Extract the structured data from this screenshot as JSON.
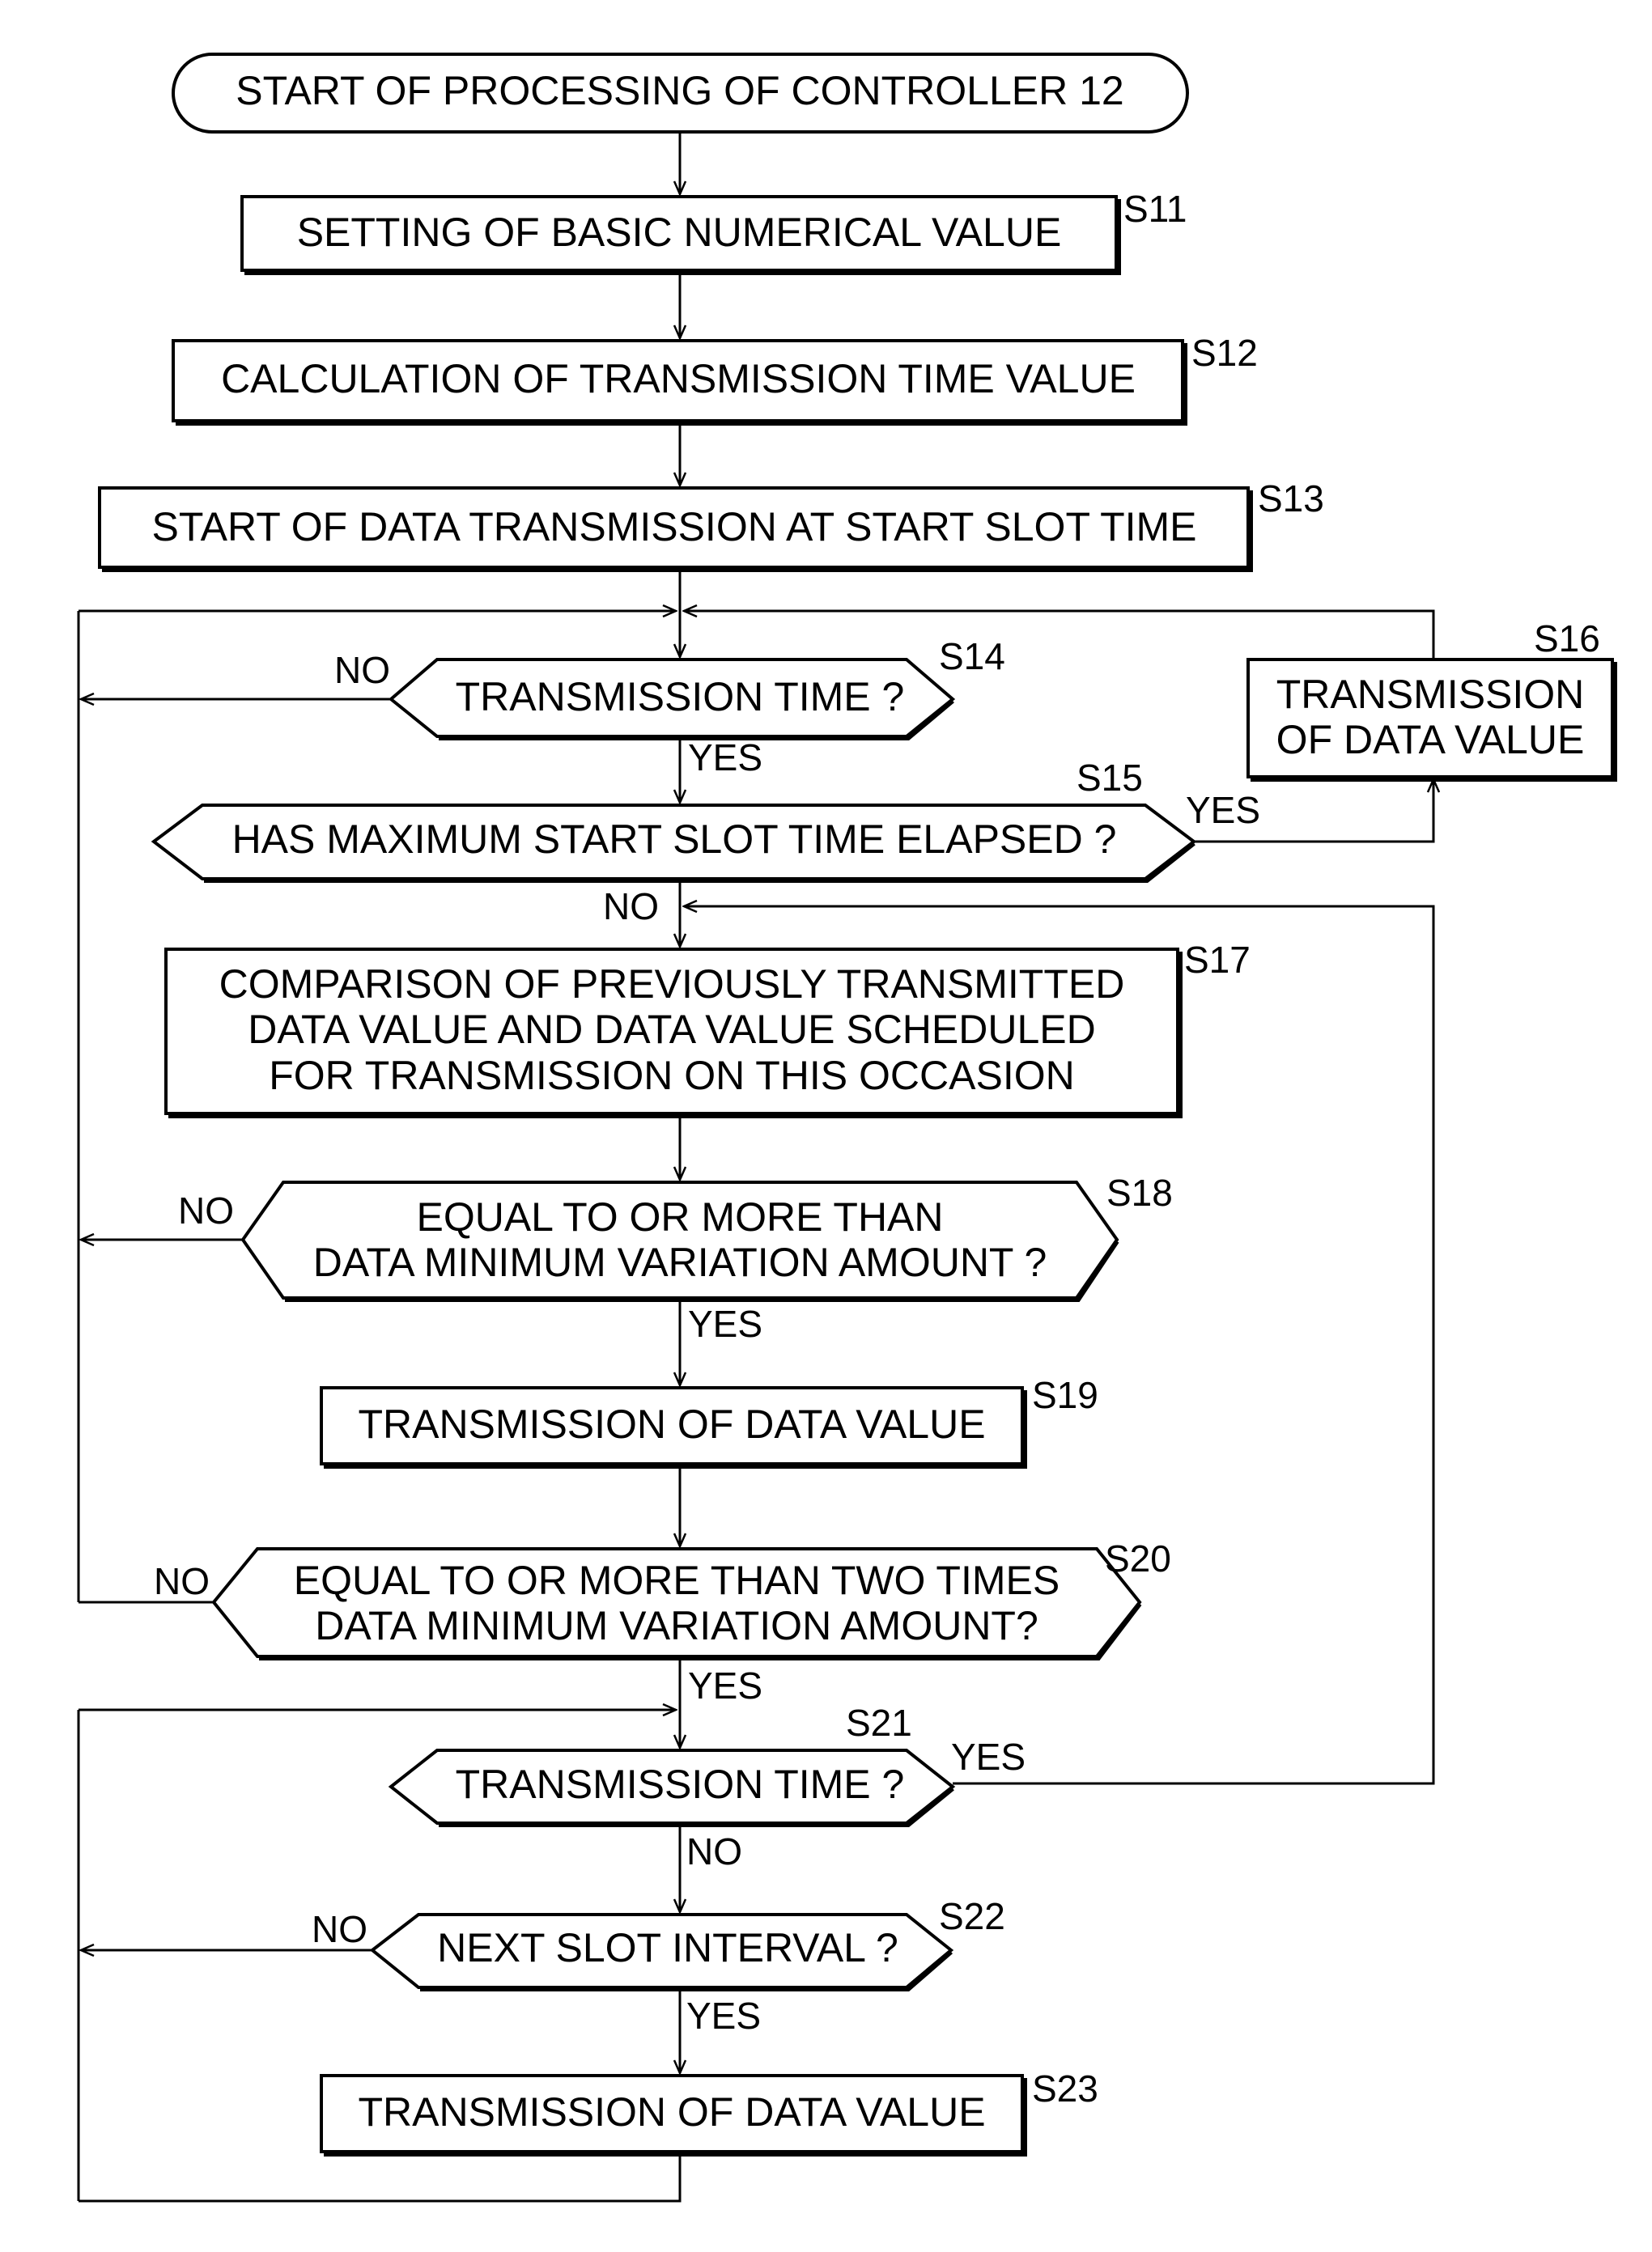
{
  "diagram": {
    "type": "flowchart",
    "start": {
      "text": "START OF PROCESSING OF CONTROLLER 12"
    },
    "steps": {
      "S11": {
        "id": "S11",
        "kind": "process",
        "lines": [
          "SETTING OF BASIC NUMERICAL VALUE"
        ]
      },
      "S12": {
        "id": "S12",
        "kind": "process",
        "lines": [
          "CALCULATION OF TRANSMISSION TIME VALUE"
        ]
      },
      "S13": {
        "id": "S13",
        "kind": "process",
        "lines": [
          "START OF DATA TRANSMISSION AT START SLOT TIME"
        ]
      },
      "S14": {
        "id": "S14",
        "kind": "decision",
        "lines": [
          "TRANSMISSION TIME ?"
        ]
      },
      "S15": {
        "id": "S15",
        "kind": "decision",
        "lines": [
          "HAS MAXIMUM START SLOT TIME ELAPSED ?"
        ]
      },
      "S16": {
        "id": "S16",
        "kind": "process",
        "lines": [
          "TRANSMISSION",
          "OF DATA VALUE"
        ]
      },
      "S17": {
        "id": "S17",
        "kind": "process",
        "lines": [
          "COMPARISON OF PREVIOUSLY TRANSMITTED",
          "DATA VALUE AND DATA VALUE SCHEDULED",
          "FOR TRANSMISSION ON THIS OCCASION"
        ]
      },
      "S18": {
        "id": "S18",
        "kind": "decision",
        "lines": [
          "EQUAL TO OR MORE THAN",
          "DATA MINIMUM VARIATION AMOUNT ?"
        ]
      },
      "S19": {
        "id": "S19",
        "kind": "process",
        "lines": [
          "TRANSMISSION OF DATA VALUE"
        ]
      },
      "S20": {
        "id": "S20",
        "kind": "decision",
        "lines": [
          "EQUAL TO OR MORE THAN TWO TIMES",
          "DATA MINIMUM VARIATION AMOUNT?"
        ]
      },
      "S21": {
        "id": "S21",
        "kind": "decision",
        "lines": [
          "TRANSMISSION TIME ?"
        ]
      },
      "S22": {
        "id": "S22",
        "kind": "decision",
        "lines": [
          "NEXT SLOT INTERVAL ?"
        ]
      },
      "S23": {
        "id": "S23",
        "kind": "process",
        "lines": [
          "TRANSMISSION OF DATA VALUE"
        ]
      }
    },
    "branch_labels": {
      "yes": "YES",
      "no": "NO"
    },
    "edges": [
      {
        "from": "start",
        "to": "S11"
      },
      {
        "from": "S11",
        "to": "S12"
      },
      {
        "from": "S12",
        "to": "S13"
      },
      {
        "from": "S13",
        "to": "S14"
      },
      {
        "from": "S14",
        "to": "S15",
        "label": "YES"
      },
      {
        "from": "S14",
        "to": "S14",
        "label": "NO"
      },
      {
        "from": "S15",
        "to": "S16",
        "label": "YES"
      },
      {
        "from": "S15",
        "to": "S17",
        "label": "NO"
      },
      {
        "from": "S16",
        "to": "S14"
      },
      {
        "from": "S17",
        "to": "S18"
      },
      {
        "from": "S18",
        "to": "S19",
        "label": "YES"
      },
      {
        "from": "S18",
        "to": "S14",
        "label": "NO"
      },
      {
        "from": "S19",
        "to": "S20"
      },
      {
        "from": "S20",
        "to": "S21",
        "label": "YES"
      },
      {
        "from": "S20",
        "to": "S14",
        "label": "NO"
      },
      {
        "from": "S21",
        "to": "S17",
        "label": "YES"
      },
      {
        "from": "S21",
        "to": "S22",
        "label": "NO"
      },
      {
        "from": "S22",
        "to": "S23",
        "label": "YES"
      },
      {
        "from": "S22",
        "to": "S21",
        "label": "NO"
      },
      {
        "from": "S23",
        "to": "S21"
      }
    ]
  }
}
